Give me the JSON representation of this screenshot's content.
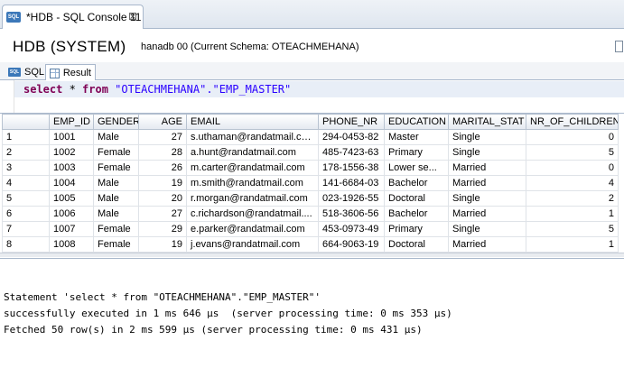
{
  "editor_tab": {
    "title": "*HDB - SQL Console 11",
    "icon": "sql-console-icon",
    "close": "⊠"
  },
  "header": {
    "title": "HDB (SYSTEM)",
    "info": "hanadb 00 (Current Schema: OTEACHMEHANA)"
  },
  "subtabs": {
    "sql": "SQL",
    "result": "Result"
  },
  "editor": {
    "kw_select": "select",
    "star": " * ",
    "kw_from": "from",
    "table_ref": " \"OTEACHMEHANA\".\"EMP_MASTER\""
  },
  "grid": {
    "columns": [
      "",
      "EMP_ID",
      "GENDER",
      "AGE",
      "EMAIL",
      "PHONE_NR",
      "EDUCATION",
      "MARITAL_STAT",
      "NR_OF_CHILDREN"
    ],
    "rows": [
      [
        "1",
        "1001",
        "Male",
        "27",
        "s.uthaman@randatmail.com",
        "294-0453-82",
        "Master",
        "Single",
        "0"
      ],
      [
        "2",
        "1002",
        "Female",
        "28",
        "a.hunt@randatmail.com",
        "485-7423-63",
        "Primary",
        "Single",
        "5"
      ],
      [
        "3",
        "1003",
        "Female",
        "26",
        "m.carter@randatmail.com",
        "178-1556-38",
        "Lower se...",
        "Married",
        "0"
      ],
      [
        "4",
        "1004",
        "Male",
        "19",
        "m.smith@randatmail.com",
        "141-6684-03",
        "Bachelor",
        "Married",
        "4"
      ],
      [
        "5",
        "1005",
        "Male",
        "20",
        "r.morgan@randatmail.com",
        "023-1926-55",
        "Doctoral",
        "Single",
        "2"
      ],
      [
        "6",
        "1006",
        "Male",
        "27",
        "c.richardson@randatmail....",
        "518-3606-56",
        "Bachelor",
        "Married",
        "1"
      ],
      [
        "7",
        "1007",
        "Female",
        "29",
        "e.parker@randatmail.com",
        "453-0973-49",
        "Primary",
        "Single",
        "5"
      ],
      [
        "8",
        "1008",
        "Female",
        "19",
        "j.evans@randatmail.com",
        "664-9063-19",
        "Doctoral",
        "Married",
        "1"
      ]
    ]
  },
  "messages": {
    "line1": "Statement 'select * from \"OTEACHMEHANA\".\"EMP_MASTER\"'",
    "line2": "successfully executed in 1 ms 646 µs  (server processing time: 0 ms 353 µs)",
    "line3": "Fetched 50 row(s) in 2 ms 599 µs (server processing time: 0 ms 431 µs)"
  }
}
